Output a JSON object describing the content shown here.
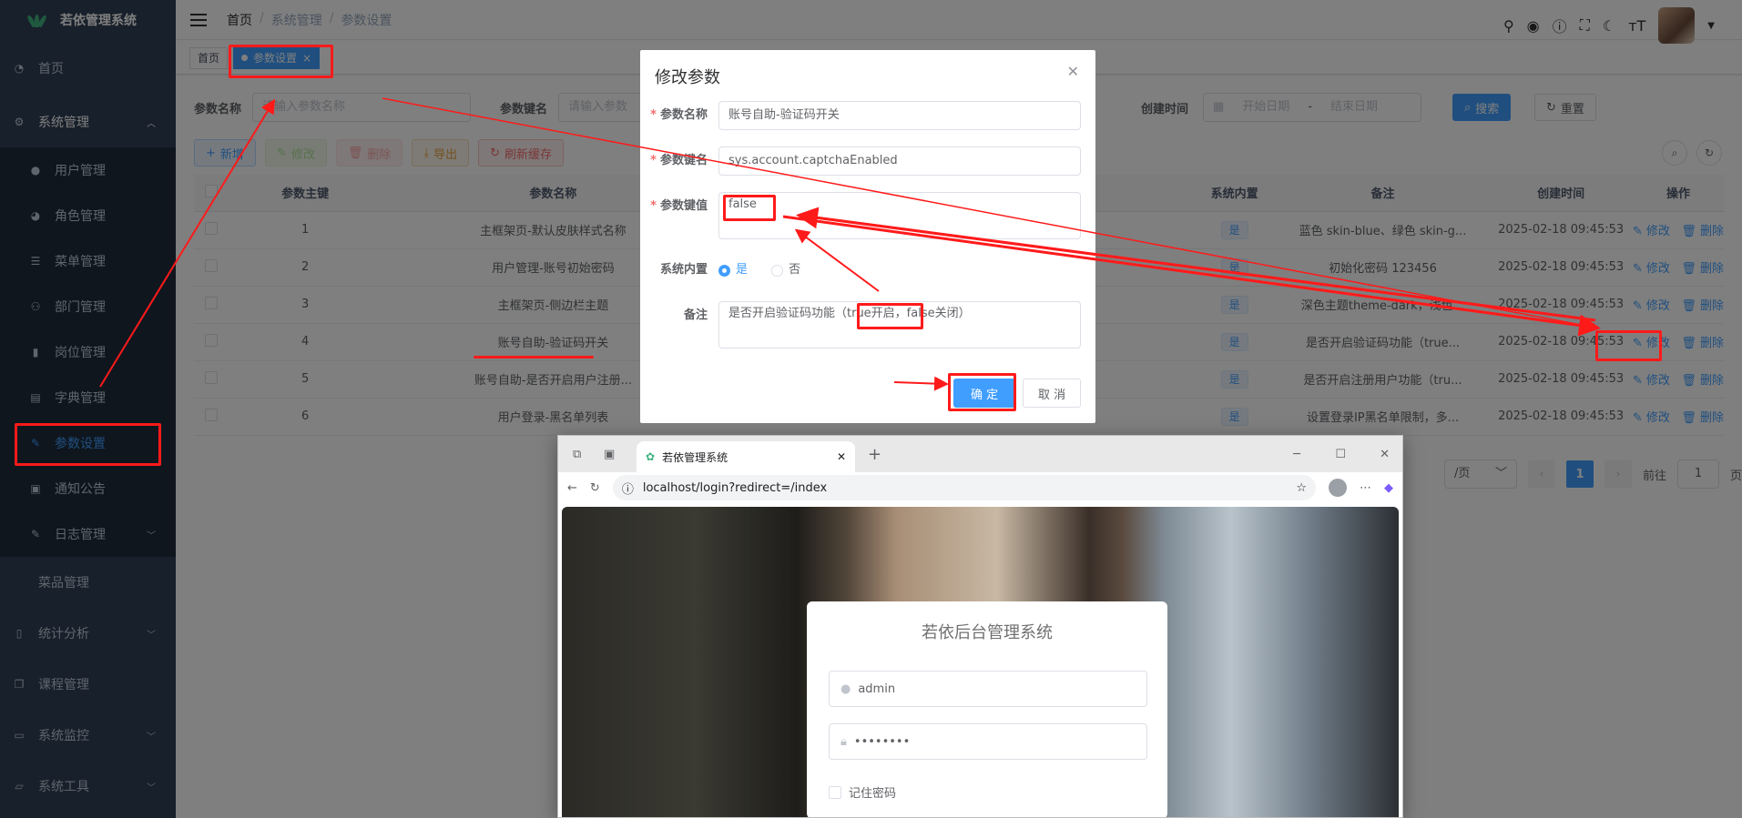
{
  "app": {
    "title": "若依管理系统"
  },
  "sidebar": {
    "items": [
      {
        "label": "首页",
        "icon": "dashboard-icon"
      },
      {
        "label": "系统管理",
        "icon": "gear-icon"
      },
      {
        "label": "用户管理",
        "icon": "user-icon"
      },
      {
        "label": "角色管理",
        "icon": "role-icon"
      },
      {
        "label": "菜单管理",
        "icon": "list-icon"
      },
      {
        "label": "部门管理",
        "icon": "tree-icon"
      },
      {
        "label": "岗位管理",
        "icon": "post-icon"
      },
      {
        "label": "字典管理",
        "icon": "dict-icon"
      },
      {
        "label": "参数设置",
        "icon": "edit-icon"
      },
      {
        "label": "通知公告",
        "icon": "message-icon"
      },
      {
        "label": "日志管理",
        "icon": "log-icon"
      },
      {
        "label": "菜品管理",
        "icon": ""
      },
      {
        "label": "统计分析",
        "icon": "phone-icon"
      },
      {
        "label": "课程管理",
        "icon": "copy-icon"
      },
      {
        "label": "系统监控",
        "icon": "monitor-icon"
      },
      {
        "label": "系统工具",
        "icon": "tool-icon"
      }
    ]
  },
  "breadcrumb": [
    "首页",
    "系统管理",
    "参数设置"
  ],
  "tags": [
    "首页",
    "参数设置"
  ],
  "search": {
    "name_label": "参数名称",
    "name_placeholder": "请输入参数名称",
    "key_label": "参数键名",
    "key_placeholder": "请输入参数",
    "time_label": "创建时间",
    "start_placeholder": "开始日期",
    "range_sep": "-",
    "end_placeholder": "结束日期",
    "search_btn": "搜索",
    "reset_btn": "重置"
  },
  "toolbar": {
    "add": "新增",
    "edit": "修改",
    "delete": "删除",
    "export": "导出",
    "refresh": "刷新缓存"
  },
  "table": {
    "headers": [
      "参数主键",
      "参数名称",
      "系统内置",
      "备注",
      "创建时间",
      "操作"
    ],
    "rows": [
      {
        "id": "1",
        "name": "主框架页-默认皮肤样式名称",
        "builtin": "是",
        "remark": "蓝色 skin-blue、绿色 skin-g...",
        "time": "2025-02-18 09:45:53"
      },
      {
        "id": "2",
        "name": "用户管理-账号初始密码",
        "builtin": "是",
        "remark": "初始化密码 123456",
        "time": "2025-02-18 09:45:53"
      },
      {
        "id": "3",
        "name": "主框架页-侧边栏主题",
        "builtin": "是",
        "remark": "深色主题theme-dark，浅色...",
        "time": "2025-02-18 09:45:53"
      },
      {
        "id": "4",
        "name": "账号自助-验证码开关",
        "builtin": "是",
        "remark": "是否开启验证码功能（true...",
        "time": "2025-02-18 09:45:53"
      },
      {
        "id": "5",
        "name": "账号自助-是否开启用户注册...",
        "builtin": "是",
        "remark": "是否开启注册用户功能（tru...",
        "time": "2025-02-18 09:45:53"
      },
      {
        "id": "6",
        "name": "用户登录-黑名单列表",
        "builtin": "是",
        "remark": "设置登录IP黑名单限制，多...",
        "time": "2025-02-18 09:45:53"
      }
    ],
    "op_edit": "修改",
    "op_delete": "删除"
  },
  "pager": {
    "per_page": "/页",
    "current": "1",
    "goto_label": "前往",
    "goto_value": "1",
    "page_suffix": "页"
  },
  "dialog": {
    "title": "修改参数",
    "name_label": "参数名称",
    "name_value": "账号自助-验证码开关",
    "key_label": "参数键名",
    "key_value": "sys.account.captchaEnabled",
    "val_label": "参数键值",
    "val_value": "false",
    "builtin_label": "系统内置",
    "opt_yes": "是",
    "opt_no": "否",
    "remark_label": "备注",
    "remark_value": "是否开启验证码功能（true开启，false关闭）",
    "confirm": "确 定",
    "cancel": "取 消"
  },
  "browser": {
    "tab_title": "若依管理系统",
    "url": "localhost/login?redirect=/index",
    "login_title": "若依后台管理系统",
    "username": "admin",
    "password": "••••••••",
    "remember": "记住密码"
  },
  "colors": {
    "sidebar": "#304156",
    "primary": "#409eff",
    "annotation": "#ff1a1a"
  }
}
